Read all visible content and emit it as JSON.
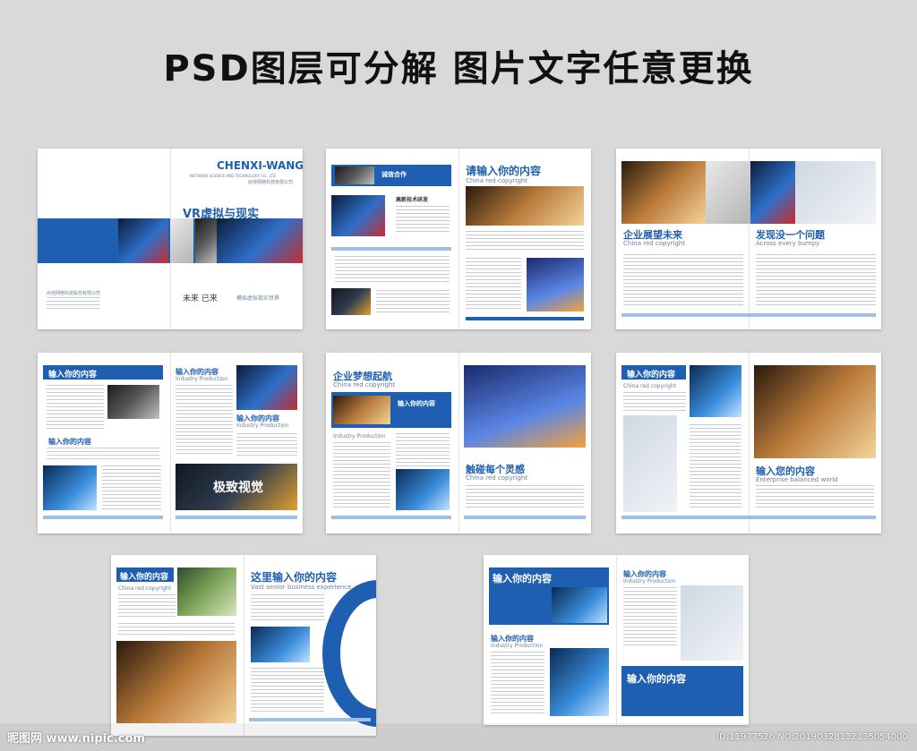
{
  "headline": "PSD图层可分解   图片文字任意更换",
  "spread1": {
    "brand": "CHENXI-WANG",
    "brand_sub": "NETWORK SCIENCE AND TECHNOLOGY CO., LTD",
    "company": "尚佳网络科技有限公司",
    "vr_title": "VR虚拟与现实",
    "future": "未来 已来",
    "tagline": "模拟虚拟现实世界",
    "left_company": "尚佳网络科技股份有限公司"
  },
  "spread2": {
    "tab": "诚信合作",
    "tech": "高新技术研发",
    "title": "请输入你的内容",
    "sub": "China red copyright"
  },
  "spread3": {
    "title1": "企业展望未来",
    "sub1": "China red copyright",
    "title2": "发现没一个问题",
    "sub2": "Across every bumpy"
  },
  "spread4": {
    "title1": "输入你的内容",
    "title2": "输入你的内容",
    "title3": "输入你的内容",
    "sub3": "Industry Production",
    "title4": "输入你的内容",
    "sub4": "Industry Production",
    "banner": "极致视觉"
  },
  "spread5": {
    "title1": "企业梦想起航",
    "sub1": "China red copyright",
    "tab": "输入你的内容",
    "prod": "Industry Production",
    "title2": "触碰每个灵感",
    "sub2": "China red copyright"
  },
  "spread6": {
    "tab": "输入你的内容",
    "sub": "China red copyright",
    "title": "输入您的内容",
    "title_sub": "Enterprise balanced world"
  },
  "spread7": {
    "tab": "输入你的内容",
    "sub": "China red copyright",
    "title": "这里输入你的内容",
    "title_sub": "Vast senior business experience"
  },
  "spread8": {
    "tab1": "输入你的内容",
    "title2": "输入你的内容",
    "sub2": "Industry Production",
    "title3": "输入你的内容",
    "sub3": "Industry Production",
    "tab4": "输入你的内容"
  },
  "footer": {
    "watermark": "昵图网 www.nipic.com",
    "meta": "ID:11977526 NO:20190328132135054000"
  }
}
